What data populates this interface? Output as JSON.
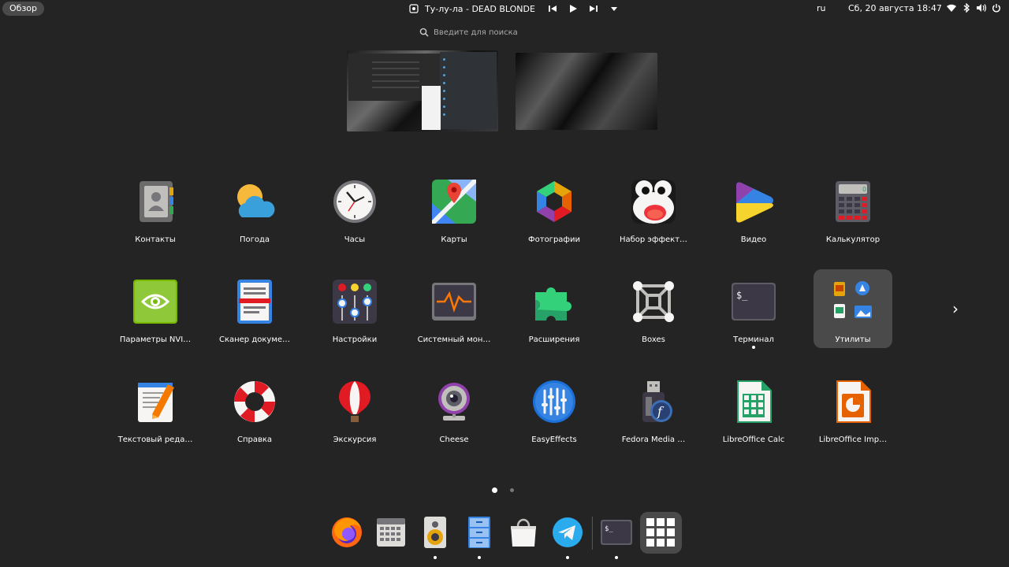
{
  "topbar": {
    "overview_label": "Обзор",
    "media_title": "Ту-лу-ла - DEAD BLONDE",
    "lang": "ru",
    "clock": "Сб, 20 августа  18:47"
  },
  "search": {
    "placeholder": "Введите для поиска"
  },
  "apps": [
    {
      "label": "Контакты"
    },
    {
      "label": "Погода"
    },
    {
      "label": "Часы"
    },
    {
      "label": "Карты"
    },
    {
      "label": "Фотографии"
    },
    {
      "label": "Набор эффект…"
    },
    {
      "label": "Видео"
    },
    {
      "label": "Калькулятор"
    },
    {
      "label": "Параметры NVI…"
    },
    {
      "label": "Сканер докуме…"
    },
    {
      "label": "Настройки"
    },
    {
      "label": "Системный мон…"
    },
    {
      "label": "Расширения"
    },
    {
      "label": "Boxes"
    },
    {
      "label": "Терминал"
    },
    {
      "label": "Утилиты"
    },
    {
      "label": "Текстовый реда…"
    },
    {
      "label": "Справка"
    },
    {
      "label": "Экскурсия"
    },
    {
      "label": "Cheese"
    },
    {
      "label": "EasyEffects"
    },
    {
      "label": "Fedora Media …"
    },
    {
      "label": "LibreOffice Calc"
    },
    {
      "label": "LibreOffice Imp…"
    }
  ],
  "pager": {
    "pages": 2,
    "current": 1
  },
  "dock": [
    "firefox-icon",
    "calendar-icon",
    "rhythmbox-icon",
    "files-icon",
    "software-icon",
    "telegram-icon",
    "terminal-icon",
    "app-grid-icon"
  ]
}
